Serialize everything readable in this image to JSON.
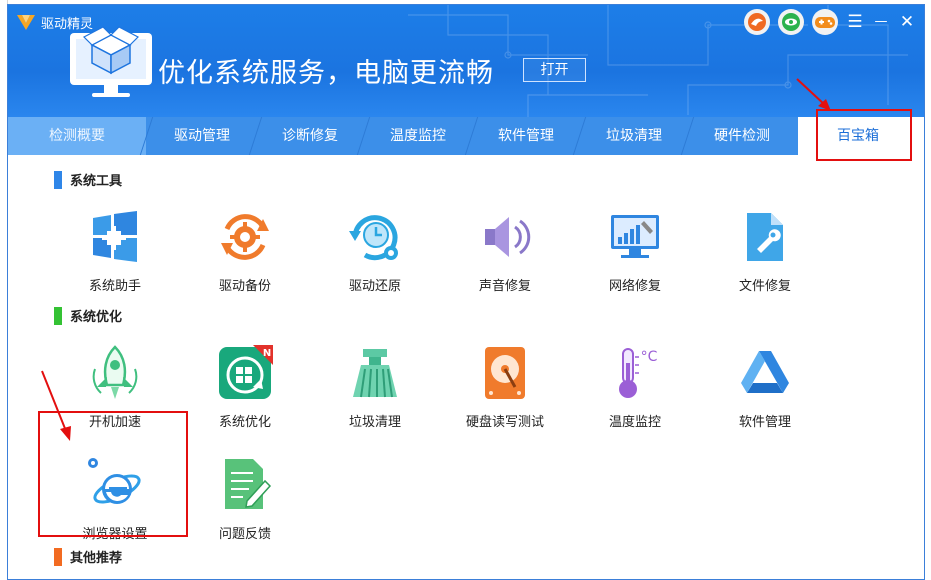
{
  "app": {
    "title": "驱动精灵",
    "banner_text": "优化系统服务，电脑更流畅",
    "banner_button": "打开",
    "window_controls": {
      "menu": "☰",
      "minimize": "—",
      "close": "✕"
    },
    "top_icons": [
      "bird-icon",
      "eye-icon",
      "gamepad-icon"
    ]
  },
  "tabs": [
    {
      "label": "检测概要",
      "active": true
    },
    {
      "label": "驱动管理"
    },
    {
      "label": "诊断修复"
    },
    {
      "label": "温度监控"
    },
    {
      "label": "软件管理"
    },
    {
      "label": "垃圾清理"
    },
    {
      "label": "硬件检测"
    },
    {
      "label": "百宝箱"
    }
  ],
  "sections": {
    "system_tools": {
      "title": "系统工具",
      "color": "#2f86e8",
      "items": [
        "系统助手",
        "驱动备份",
        "驱动还原",
        "声音修复",
        "网络修复",
        "文件修复"
      ]
    },
    "system_optimize": {
      "title": "系统优化",
      "color": "#34c234",
      "items": [
        "开机加速",
        "系统优化",
        "垃圾清理",
        "硬盘读写测试",
        "温度监控",
        "软件管理",
        "浏览器设置",
        "问题反馈"
      ]
    },
    "other": {
      "title": "其他推荐",
      "color": "#f26b21"
    }
  },
  "badges": {
    "new": "N"
  },
  "temperature_unit": "°C",
  "colors": {
    "header": "#1b74e0",
    "highlight": "#e30f0f"
  }
}
